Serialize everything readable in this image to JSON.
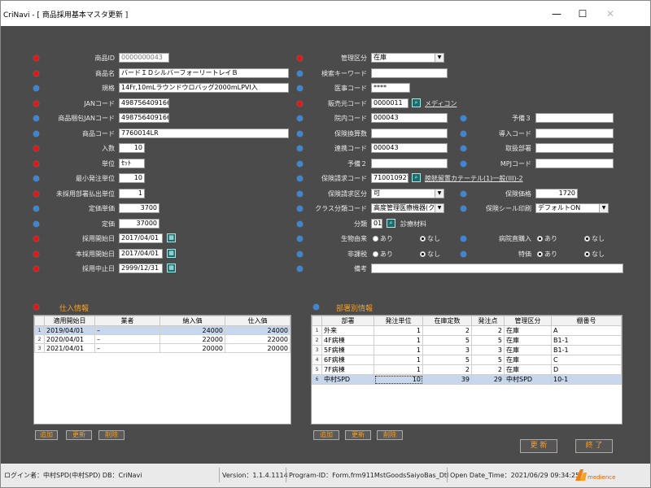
{
  "window": {
    "title": "CriNavi - [ 商品採用基本マスタ更新 ]",
    "minimize": "—",
    "maximize": "☐",
    "close": "✕"
  },
  "left": {
    "shohin_id": {
      "label": "商品ID",
      "value": "0000000043"
    },
    "shohin_mei": {
      "label": "商品名",
      "value": "バードＩＤシルバーフォーリートレイＢ"
    },
    "kikaku": {
      "label": "規格",
      "value": "14Fr,10mLラウンドウロバッグ2000mLPVI入"
    },
    "jan": {
      "label": "JANコード",
      "value": "4987564091660"
    },
    "shohin_jan": {
      "label": "商品梱包JANコード",
      "value": "4987564091660"
    },
    "shohin_code": {
      "label": "商品コード",
      "value": "7760014LR"
    },
    "irisu": {
      "label": "入数",
      "value": "10"
    },
    "tani": {
      "label": "単位",
      "value": "ｾｯﾄ"
    },
    "saisho": {
      "label": "最小発注単位",
      "value": "10"
    },
    "mi_saiyo": {
      "label": "未採用部署払出単位",
      "value": "1"
    },
    "teika_tanka": {
      "label": "定価単価",
      "value": "3700"
    },
    "teika": {
      "label": "定価",
      "value": "37000"
    },
    "saiyo_kaishi": {
      "label": "採用開始日",
      "value": "2017/04/01"
    },
    "honsaiyo_kaishi": {
      "label": "本採用開始日",
      "value": "2017/04/01"
    },
    "saiyo_chushi": {
      "label": "採用中止日",
      "value": "2999/12/31"
    }
  },
  "mid": {
    "kanri_kubun": {
      "label": "管理区分",
      "value": "在庫"
    },
    "kensaku": {
      "label": "検索キーワード",
      "value": ""
    },
    "ishi_code": {
      "label": "医事コード",
      "value": "****"
    },
    "hanbaimoto": {
      "label": "販売元コード",
      "value": "0000011",
      "link": "メディコン"
    },
    "innai": {
      "label": "院内コード",
      "value": "000043"
    },
    "hoken_kansan": {
      "label": "保険換算数",
      "value": ""
    },
    "renkei": {
      "label": "連携コード",
      "value": "000043"
    },
    "yobi2": {
      "label": "予備２",
      "value": ""
    },
    "hoken_seikyu": {
      "label": "保険請求コード",
      "value": "710010927",
      "link": "膀胱留置カテーテル(1)一般(III)-2"
    },
    "hoken_seikyu_kubun": {
      "label": "保険請求区分",
      "value": "可"
    },
    "class_bunrui": {
      "label": "クラス分類コード",
      "value": "高度管理医療機器(ク"
    },
    "bunrui": {
      "label": "分類",
      "value": "01",
      "link": "診療材料"
    },
    "seibutsu": {
      "label": "生物由来",
      "opt1": "あり",
      "opt2": "なし"
    },
    "hikazei": {
      "label": "非課税",
      "opt1": "あり",
      "opt2": "なし"
    },
    "biko": {
      "label": "備考",
      "value": ""
    }
  },
  "right": {
    "yobi3": {
      "label": "予備３",
      "value": ""
    },
    "donyu": {
      "label": "導入コード",
      "value": ""
    },
    "tanto": {
      "label": "取扱部署",
      "value": ""
    },
    "mpj": {
      "label": "MPJコード",
      "value": ""
    },
    "hoken_kakaku": {
      "label": "保険価格",
      "value": "1720"
    },
    "hoken_seal": {
      "label": "保険シール印刷",
      "value": "デフォルトON"
    },
    "byoin_konyu": {
      "label": "病院直購入",
      "opt1": "あり",
      "opt2": "なし"
    },
    "tokka": {
      "label": "特価",
      "opt1": "あり",
      "opt2": "なし"
    }
  },
  "shiire": {
    "title": "仕入情報",
    "columns": [
      "適用開始日",
      "業者",
      "納入価",
      "仕入価"
    ],
    "rows": [
      {
        "no": "1",
        "date": "2019/04/01",
        "gyosha": "–",
        "nonyu": "24000",
        "shiire": "24000"
      },
      {
        "no": "2",
        "date": "2020/04/01",
        "gyosha": "–",
        "nonyu": "22000",
        "shiire": "22000"
      },
      {
        "no": "3",
        "date": "2021/04/01",
        "gyosha": "–",
        "nonyu": "20000",
        "shiire": "20000"
      }
    ],
    "buttons": {
      "add": "追加",
      "edit": "更新",
      "del": "削除"
    }
  },
  "busho": {
    "title": "部署別情報",
    "columns": [
      "部署",
      "発注単位",
      "在庫定数",
      "発注点",
      "管理区分",
      "棚番号"
    ],
    "rows": [
      {
        "no": "1",
        "busho": "外来",
        "tani": "1",
        "teisu": "2",
        "ten": "2",
        "kubun": "在庫",
        "tana": "A"
      },
      {
        "no": "2",
        "busho": "4F病棟",
        "tani": "1",
        "teisu": "5",
        "ten": "5",
        "kubun": "在庫",
        "tana": "B1-1"
      },
      {
        "no": "3",
        "busho": "5F病棟",
        "tani": "1",
        "teisu": "3",
        "ten": "3",
        "kubun": "在庫",
        "tana": "B1-1"
      },
      {
        "no": "4",
        "busho": "6F病棟",
        "tani": "1",
        "teisu": "5",
        "ten": "5",
        "kubun": "在庫",
        "tana": "C"
      },
      {
        "no": "5",
        "busho": "7F病棟",
        "tani": "1",
        "teisu": "2",
        "ten": "2",
        "kubun": "在庫",
        "tana": "D"
      },
      {
        "no": "6",
        "busho": "中村SPD",
        "tani": "10",
        "teisu": "39",
        "ten": "29",
        "kubun": "中村SPD",
        "tana": "10-1"
      }
    ],
    "buttons": {
      "add": "追加",
      "edit": "更新",
      "del": "削除"
    }
  },
  "actions": {
    "update": "更 新",
    "close": "終 了"
  },
  "status": {
    "user": "ログイン者：中村SPD(中村SPD)  DB：CriNavi",
    "version": "Version：1.1.4.1114",
    "program": "Program-ID：Form.frm911MstGoodsSaiyoBas_Dtl",
    "open": "Open Date_Time：2021/06/29 09:34:25",
    "logo": "medience"
  },
  "colors": {
    "bg": "#4b4b4b",
    "accent": "#f0a030",
    "required": "#e01818",
    "optional": "#3a86d8"
  }
}
